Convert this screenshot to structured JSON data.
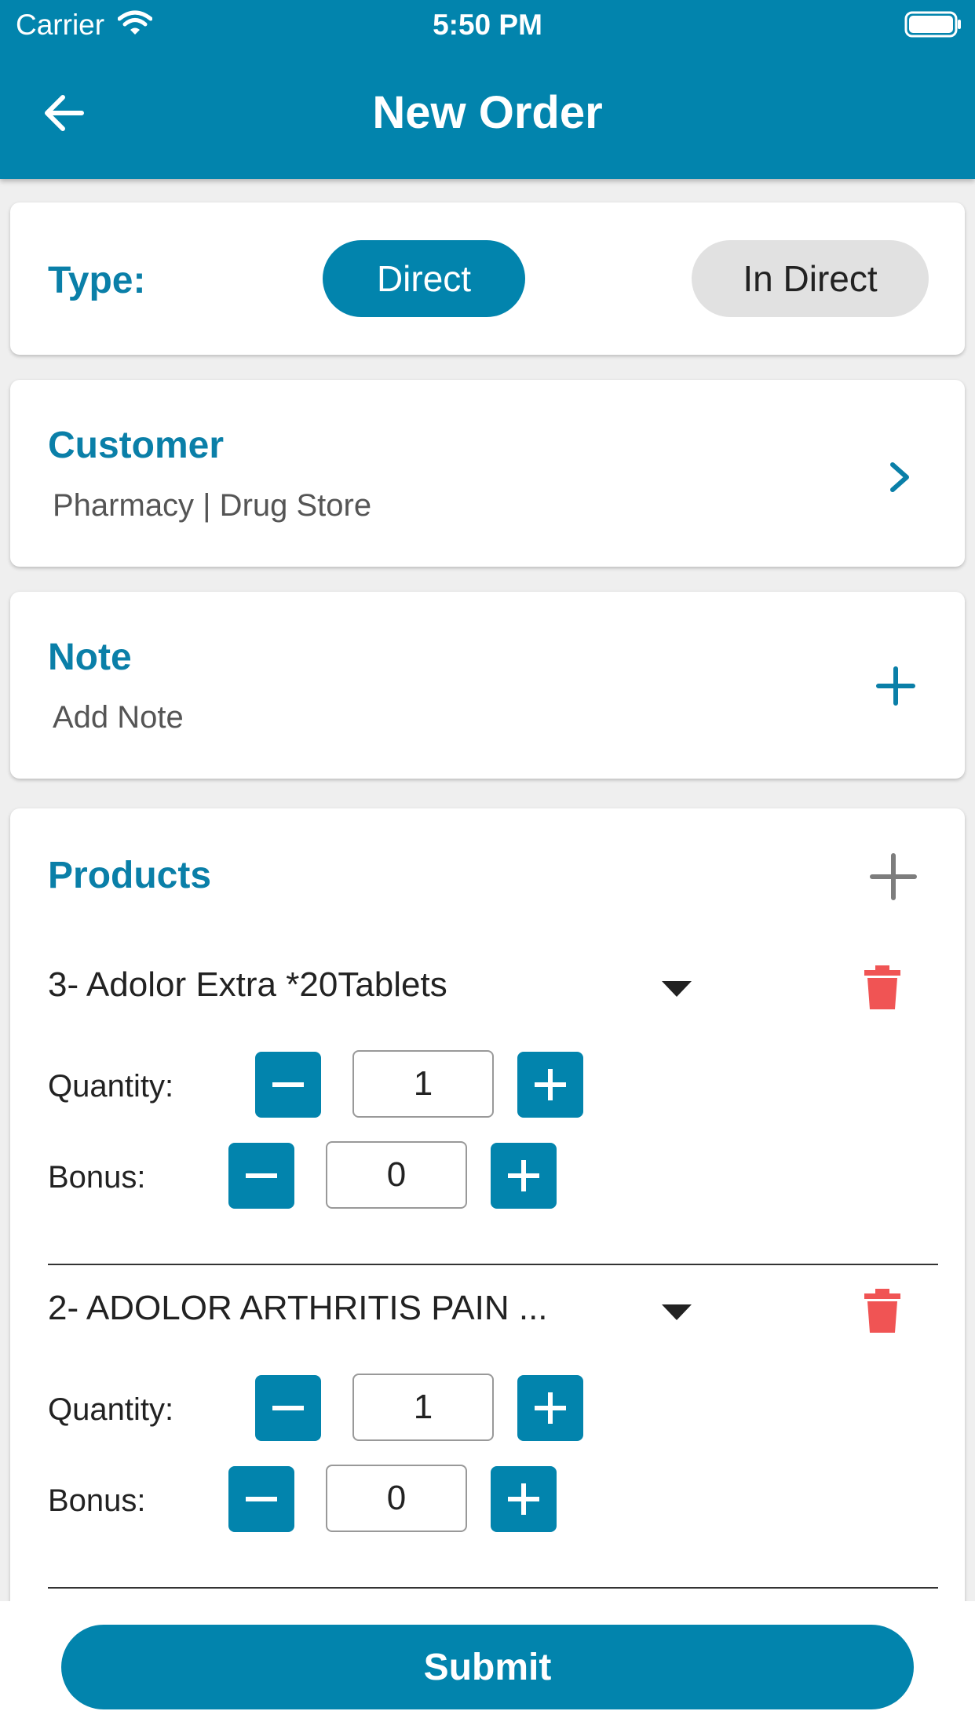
{
  "status_bar": {
    "carrier": "Carrier",
    "time": "5:50 PM"
  },
  "header": {
    "title": "New Order",
    "back_icon": "arrow-left-icon"
  },
  "type_section": {
    "label": "Type:",
    "options": [
      "Direct",
      "In Direct"
    ],
    "selected": "Direct"
  },
  "customer_section": {
    "title": "Customer",
    "value": "Pharmacy | Drug Store",
    "action_icon": "chevron-right-icon"
  },
  "note_section": {
    "title": "Note",
    "placeholder": "Add Note",
    "action_icon": "plus-icon"
  },
  "products_section": {
    "title": "Products",
    "items": [
      {
        "name": "3- Adolor Extra *20Tablets",
        "quantity_label": "Quantity:",
        "quantity": "1",
        "bonus_label": "Bonus:",
        "bonus": "0"
      },
      {
        "name": "2- ADOLOR ARTHRITIS PAIN ...",
        "quantity_label": "Quantity:",
        "quantity": "1",
        "bonus_label": "Bonus:",
        "bonus": "0"
      }
    ]
  },
  "footer": {
    "submit_label": "Submit"
  },
  "colors": {
    "primary": "#0284ad",
    "accent_text": "#0a7fa8",
    "delete": "#f05454",
    "pill_inactive": "#e1e1e1"
  }
}
